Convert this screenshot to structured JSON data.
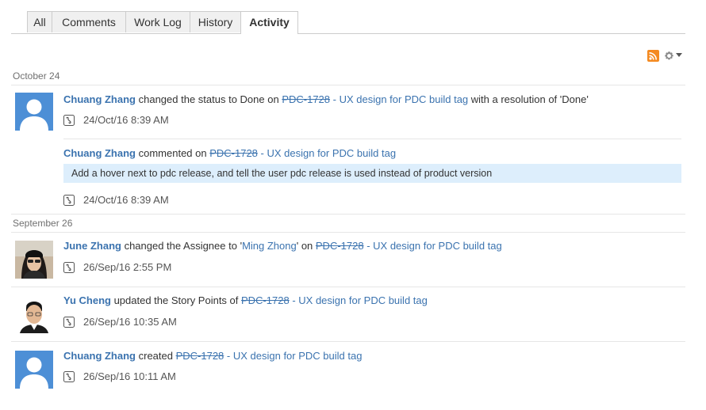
{
  "tabs": [
    {
      "label": "All"
    },
    {
      "label": "Comments"
    },
    {
      "label": "Work Log"
    },
    {
      "label": "History"
    },
    {
      "label": "Activity"
    }
  ],
  "active_tab": "Activity",
  "toolbar": {
    "rss_icon": "rss-feed-icon",
    "settings_icon": "gear-icon"
  },
  "groups": [
    {
      "date": "October 24",
      "entries": [
        {
          "user": "Chuang Zhang",
          "action": " changed the status to Done on ",
          "issue_key": "PDC-1728",
          "issue_title": " - UX design for PDC build tag",
          "suffix": " with a resolution of 'Done'",
          "timestamp": "24/Oct/16 8:39 AM"
        },
        {
          "user": "Chuang Zhang",
          "action": " commented on ",
          "issue_key": "PDC-1728",
          "issue_title": " - UX design for PDC build tag",
          "comment": "Add a hover next to pdc release, and tell the user pdc release is used instead of product version",
          "timestamp": "24/Oct/16 8:39 AM"
        }
      ]
    },
    {
      "date": "September 26",
      "entries": [
        {
          "user": "June Zhang",
          "action": " changed the Assignee to '",
          "assignee": "Ming Zhong",
          "action2": "' on ",
          "issue_key": "PDC-1728",
          "issue_title": " - UX design for PDC build tag",
          "timestamp": "26/Sep/16 2:55 PM"
        },
        {
          "user": "Yu Cheng",
          "action": " updated the Story Points of ",
          "issue_key": "PDC-1728",
          "issue_title": " - UX design for PDC build tag",
          "timestamp": "26/Sep/16 10:35 AM"
        },
        {
          "user": "Chuang Zhang",
          "action": " created ",
          "issue_key": "PDC-1728",
          "issue_title": " - UX design for PDC build tag",
          "timestamp": "26/Sep/16 10:11 AM"
        }
      ]
    }
  ],
  "colors": {
    "link": "#3b73af",
    "comment_bg": "#ddeefc",
    "rss": "#f48a21"
  }
}
